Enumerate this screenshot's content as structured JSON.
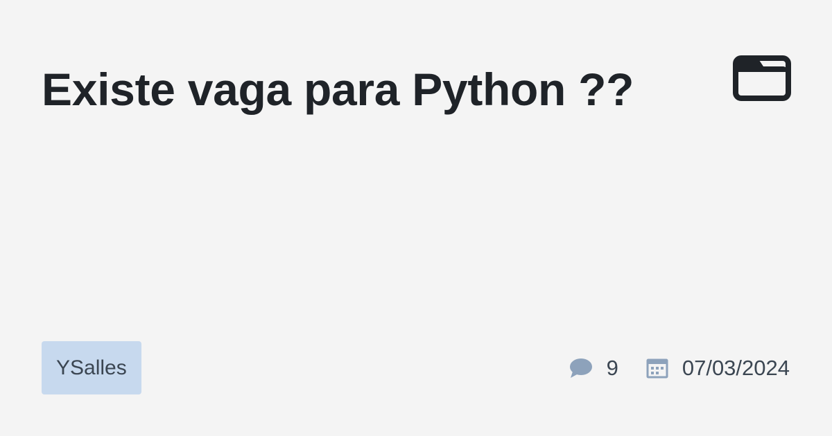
{
  "post": {
    "title": "Existe vaga para Python ??",
    "category_icon": "folder-icon",
    "author": "YSalles",
    "comments_icon": "speech-bubble-icon",
    "comments_count": "9",
    "date_icon": "calendar-icon",
    "date": "07/03/2024"
  },
  "colors": {
    "background": "#f4f4f4",
    "title": "#1f2328",
    "author_badge_bg": "#c7d9ee",
    "meta_text": "#3b4652",
    "meta_icon": "#8da2bb"
  }
}
